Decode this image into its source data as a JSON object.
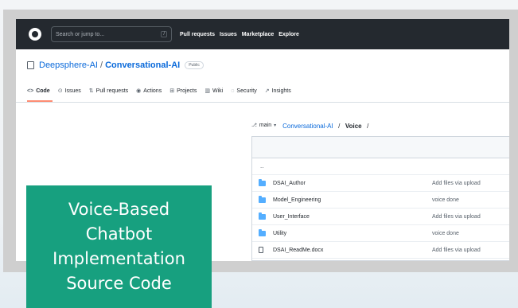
{
  "topbar": {
    "search_placeholder": "Search or jump to...",
    "search_shortcut": "/",
    "nav": [
      "Pull requests",
      "Issues",
      "Marketplace",
      "Explore"
    ]
  },
  "repo": {
    "owner": "Deepsphere-AI",
    "separator": "/",
    "name": "Conversational-AI",
    "visibility": "Public"
  },
  "tabs": [
    {
      "icon": "code-icon",
      "glyph": "<>",
      "label": "Code",
      "active": true
    },
    {
      "icon": "issue-icon",
      "glyph": "⊙",
      "label": "Issues"
    },
    {
      "icon": "pull-request-icon",
      "glyph": "⇅",
      "label": "Pull requests"
    },
    {
      "icon": "actions-icon",
      "glyph": "◉",
      "label": "Actions"
    },
    {
      "icon": "projects-icon",
      "glyph": "⊞",
      "label": "Projects"
    },
    {
      "icon": "wiki-icon",
      "glyph": "▥",
      "label": "Wiki"
    },
    {
      "icon": "security-icon",
      "glyph": "◌",
      "label": "Security"
    },
    {
      "icon": "insights-icon",
      "glyph": "↗",
      "label": "Insights"
    }
  ],
  "branch": {
    "label": "main",
    "icon": "branch-icon"
  },
  "breadcrumb": {
    "repo": "Conversational-AI",
    "sep": "/",
    "folder": "Voice",
    "trail": "/"
  },
  "files": {
    "parent": "..",
    "rows": [
      {
        "type": "folder",
        "name": "DSAI_Author",
        "message": "Add files via upload"
      },
      {
        "type": "folder",
        "name": "Model_Engineering",
        "message": "voice done"
      },
      {
        "type": "folder",
        "name": "User_Interface",
        "message": "Add files via upload"
      },
      {
        "type": "folder",
        "name": "Utility",
        "message": "voice done"
      },
      {
        "type": "file",
        "name": "DSAI_ReadMe.docx",
        "message": "Add files via upload"
      }
    ]
  },
  "banner": {
    "lines": [
      "Voice-Based",
      "Chatbot",
      "Implementation",
      "Source Code"
    ]
  },
  "colors": {
    "banner_bg": "#17a07f",
    "header_bg": "#24292f",
    "link": "#0969da",
    "folder": "#54aeff"
  }
}
